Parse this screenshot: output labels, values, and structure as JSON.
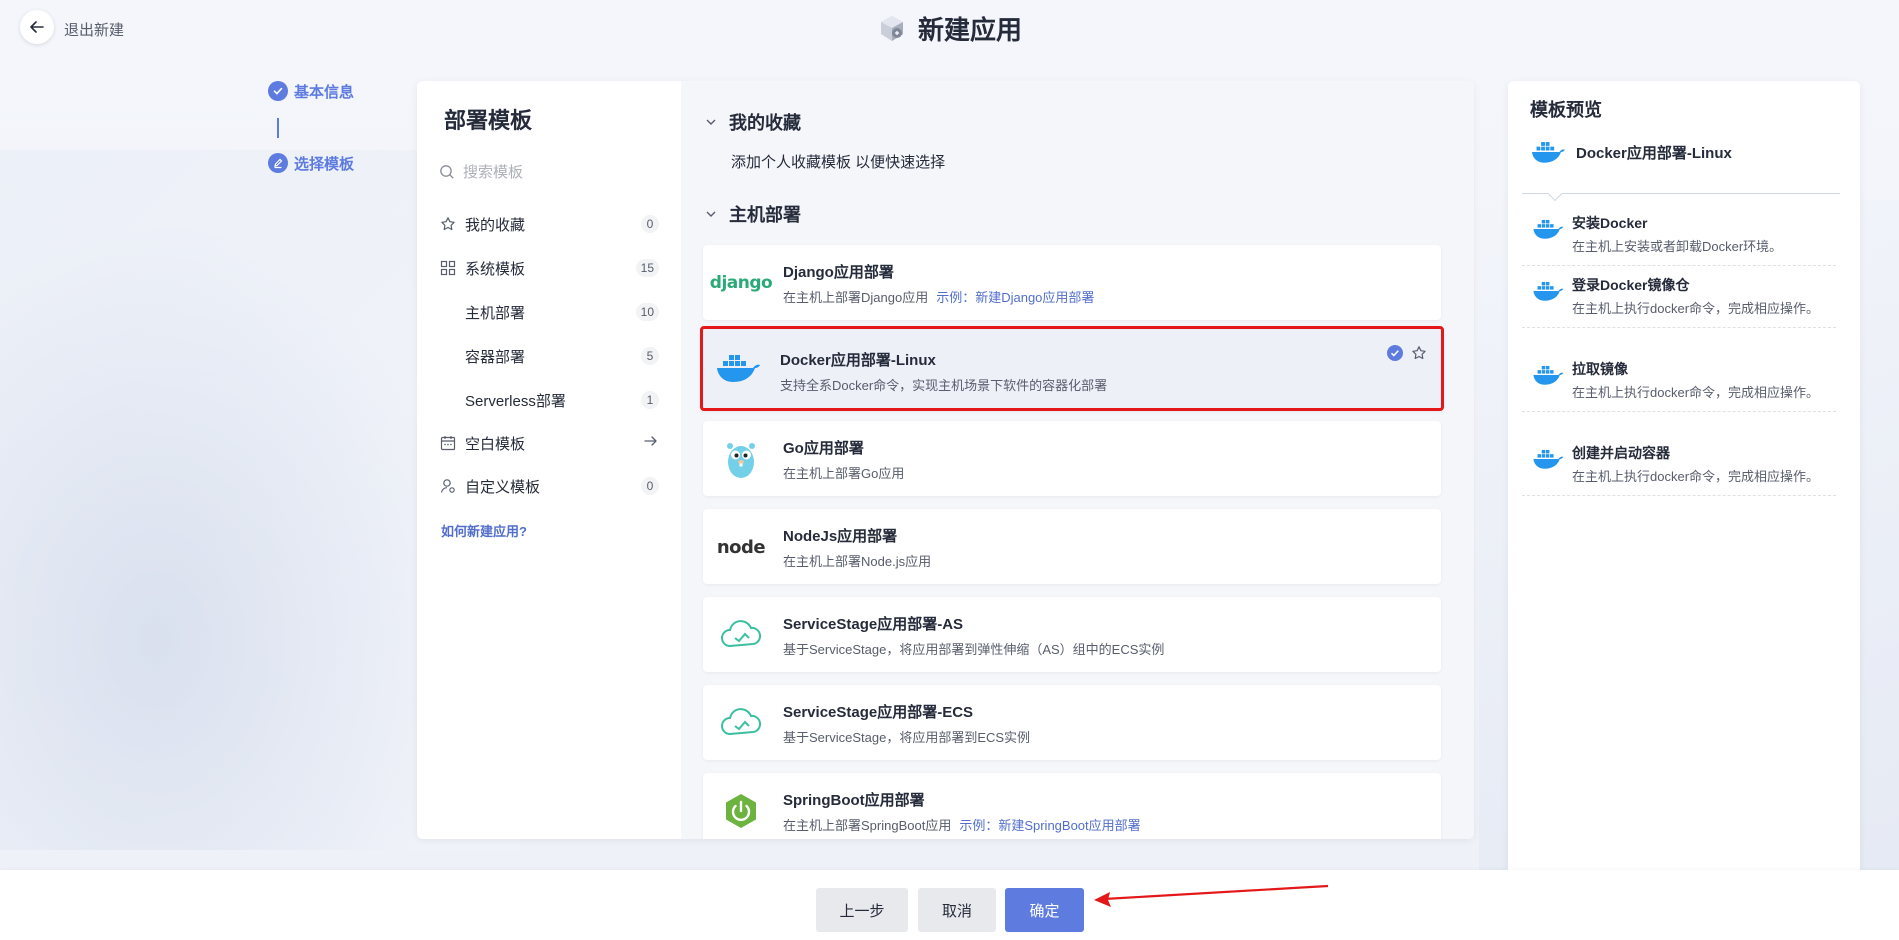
{
  "header": {
    "back_label": "退出新建",
    "title": "新建应用"
  },
  "steps": [
    {
      "label": "基本信息"
    },
    {
      "label": "选择模板"
    }
  ],
  "left_panel": {
    "title": "部署模板",
    "search_placeholder": "搜索模板",
    "nav": [
      {
        "label": "我的收藏",
        "count": "0"
      },
      {
        "label": "系统模板",
        "count": "15"
      },
      {
        "label": "主机部署",
        "count": "10"
      },
      {
        "label": "容器部署",
        "count": "5"
      },
      {
        "label": "Serverless部署",
        "count": "1"
      },
      {
        "label": "空白模板"
      },
      {
        "label": "自定义模板",
        "count": "0"
      }
    ],
    "help_link": "如何新建应用?"
  },
  "favorites": {
    "title": "我的收藏",
    "hint": "添加个人收藏模板 以便快速选择"
  },
  "host_section": {
    "title": "主机部署"
  },
  "templates": [
    {
      "name": "Django应用部署",
      "desc": "在主机上部署Django应用",
      "example": "示例：新建Django应用部署",
      "logo": "django-logo",
      "logo_text": "django"
    },
    {
      "name": "Docker应用部署-Linux",
      "desc": "支持全系Docker命令，实现主机场景下软件的容器化部署",
      "logo": "docker-logo",
      "selected": true
    },
    {
      "name": "Go应用部署",
      "desc": "在主机上部署Go应用",
      "logo": "go-gopher-logo"
    },
    {
      "name": "NodeJs应用部署",
      "desc": "在主机上部署Node.js应用",
      "logo": "nodejs-logo",
      "logo_text": "node"
    },
    {
      "name": "ServiceStage应用部署-AS",
      "desc": "基于ServiceStage，将应用部署到弹性伸缩（AS）组中的ECS实例",
      "logo": "servicestage-logo"
    },
    {
      "name": "ServiceStage应用部署-ECS",
      "desc": "基于ServiceStage，将应用部署到ECS实例",
      "logo": "servicestage-logo"
    },
    {
      "name": "SpringBoot应用部署",
      "desc": "在主机上部署SpringBoot应用",
      "example": "示例：新建SpringBoot应用部署",
      "logo": "springboot-logo"
    }
  ],
  "preview": {
    "title": "模板预览",
    "template_name": "Docker应用部署-Linux",
    "steps": [
      {
        "name": "安装Docker",
        "desc": "在主机上安装或者卸载Docker环境。"
      },
      {
        "name": "登录Docker镜像仓",
        "desc": "在主机上执行docker命令，完成相应操作。"
      },
      {
        "name": "拉取镜像",
        "desc": "在主机上执行docker命令，完成相应操作。"
      },
      {
        "name": "创建并启动容器",
        "desc": "在主机上执行docker命令，完成相应操作。"
      }
    ]
  },
  "footer": {
    "prev": "上一步",
    "cancel": "取消",
    "ok": "确定"
  },
  "colors": {
    "accent": "#5e7ce0",
    "link": "#526ecc",
    "highlight": "#e41818",
    "docker": "#2496ed",
    "django": "#2ba977",
    "servicestage": "#3bbfa0",
    "springboot": "#6db33f"
  }
}
